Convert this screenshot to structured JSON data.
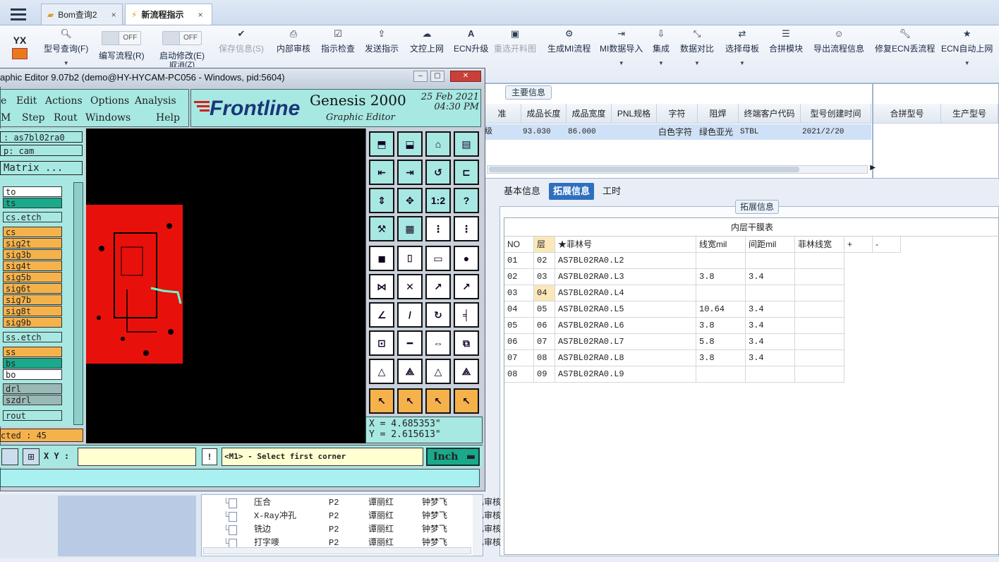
{
  "tabs": [
    {
      "label": "Bom查询2",
      "close": "×"
    },
    {
      "label": "新流程指示",
      "close": "×"
    }
  ],
  "ribbon": {
    "logo": "YX",
    "buttons": [
      {
        "label": "型号查询(F)",
        "icon": "search-icon"
      },
      {
        "label": "编写流程(R)",
        "toggle": "OFF"
      },
      {
        "label": "启动修改(E)",
        "toggle": "OFF",
        "sub": "取消(Z)"
      },
      {
        "label": "保存信息(S)",
        "icon": "check-icon",
        "disabled": true
      },
      {
        "label": "内部审核",
        "icon": "printer-icon"
      },
      {
        "label": "指示检查",
        "icon": "checkbox-icon"
      },
      {
        "label": "发送指示",
        "icon": "upload-icon"
      },
      {
        "label": "文控上网",
        "icon": "cloud-upload-icon"
      },
      {
        "label": "ECN升级",
        "icon": "font-icon"
      },
      {
        "label": "重选开料图",
        "icon": "image-icon",
        "disabled": true
      },
      {
        "label": "生成MI流程",
        "icon": "cogs-icon"
      },
      {
        "label": "MI数据导入",
        "icon": "import-icon"
      },
      {
        "label": "集成",
        "icon": "download-icon"
      },
      {
        "label": "数据对比",
        "icon": "compare-icon"
      },
      {
        "label": "选择母板",
        "icon": "shuffle-icon"
      },
      {
        "label": "合拼模块",
        "icon": "list-icon"
      },
      {
        "label": "导出流程信息",
        "icon": "smile-icon"
      },
      {
        "label": "修复ECN丢流程",
        "icon": "wrench-icon"
      },
      {
        "label": "ECN自动上网",
        "icon": "star-icon"
      }
    ]
  },
  "main_info": {
    "label": "主要信息",
    "headers": [
      "准",
      "成品长度",
      "成品宽度",
      "PNL规格",
      "字符",
      "阻焊",
      "终端客户代码",
      "型号创建时间"
    ],
    "row": [
      "级",
      "93.030",
      "86.000",
      "",
      "白色字符",
      "绿色亚光",
      "STBL",
      "2021/2/20"
    ],
    "side_headers": [
      "合拼型号",
      "生产型号"
    ]
  },
  "detail_tabs": [
    "基本信息",
    "拓展信息",
    "工时"
  ],
  "ext_group_label": "拓展信息",
  "ext_table": {
    "caption": "内层干膜表",
    "headers": [
      "NO",
      "层",
      "★菲林号",
      "线宽mil",
      "间距mil",
      "菲林线宽",
      "+",
      "-"
    ],
    "rows": [
      [
        "01",
        "02",
        "AS7BL02RA0.L2",
        "",
        "",
        ""
      ],
      [
        "02",
        "03",
        "AS7BL02RA0.L3",
        "3.8",
        "3.4",
        ""
      ],
      [
        "03",
        "04",
        "AS7BL02RA0.L4",
        "",
        "",
        ""
      ],
      [
        "04",
        "05",
        "AS7BL02RA0.L5",
        "10.64",
        "3.4",
        ""
      ],
      [
        "05",
        "06",
        "AS7BL02RA0.L6",
        "3.8",
        "3.4",
        ""
      ],
      [
        "06",
        "07",
        "AS7BL02RA0.L7",
        "5.8",
        "3.4",
        ""
      ],
      [
        "07",
        "08",
        "AS7BL02RA0.L8",
        "3.8",
        "3.4",
        ""
      ],
      [
        "08",
        "09",
        "AS7BL02RA0.L9",
        "",
        "",
        ""
      ]
    ]
  },
  "genesis": {
    "title": "aphic Editor 9.07b2 (demo@HY-HYCAM-PC056 - Windows, pid:5604)",
    "menu": [
      "e",
      "Edit",
      "Actions",
      "Options",
      "Analysis",
      "M",
      "Step",
      "Rout",
      "Windows",
      "Help"
    ],
    "brand": "Frontline",
    "product": "Genesis 2000",
    "subtitle": "Graphic Editor",
    "date": "25 Feb 2021",
    "time": "04:30 PM",
    "job": ": as7bl02ra0",
    "step": "p: cam",
    "matrix": "Matrix ...",
    "layers": [
      {
        "name": "to",
        "color": "#ffffff"
      },
      {
        "name": "ts",
        "color": "#1aa98a"
      },
      {
        "name": "cs.etch",
        "color": "#a7e8e2"
      },
      {
        "name": "cs",
        "color": "#f6b24a"
      },
      {
        "name": "sig2t",
        "color": "#f6b24a"
      },
      {
        "name": "sig3b",
        "color": "#f6b24a"
      },
      {
        "name": "sig4t",
        "color": "#f6b24a"
      },
      {
        "name": "sig5b",
        "color": "#f6b24a"
      },
      {
        "name": "sig6t",
        "color": "#f6b24a"
      },
      {
        "name": "sig7b",
        "color": "#f6b24a"
      },
      {
        "name": "sig8t",
        "color": "#f6b24a"
      },
      {
        "name": "sig9b",
        "color": "#f6b24a"
      },
      {
        "name": "ss.etch",
        "color": "#a7e8e2"
      },
      {
        "name": "ss",
        "color": "#f6b24a"
      },
      {
        "name": "bs",
        "color": "#1aa98a"
      },
      {
        "name": "bo",
        "color": "#ffffff"
      },
      {
        "name": "drl",
        "color": "#9ab8b5"
      },
      {
        "name": "szdrl",
        "color": "#9ab8b5"
      },
      {
        "name": "rout",
        "color": "#a7e8e2"
      }
    ],
    "selected": "cted : 45",
    "x_coord": "X = 4.685353\"",
    "y_coord": "Y = 2.615613\"",
    "xy_label": "X Y :",
    "prompt": "<M1> - Select first corner",
    "units": "Inch"
  },
  "flow_rows": [
    [
      "压合",
      "P2",
      "谭丽红",
      "钟梦飞",
      "已审核"
    ],
    [
      "X-Ray冲孔",
      "P2",
      "谭丽红",
      "钟梦飞",
      "已审核"
    ],
    [
      "铣边",
      "P2",
      "谭丽红",
      "钟梦飞",
      "已审核"
    ],
    [
      "打字嘜",
      "P2",
      "谭丽红",
      "钟梦飞",
      "已审核"
    ]
  ]
}
